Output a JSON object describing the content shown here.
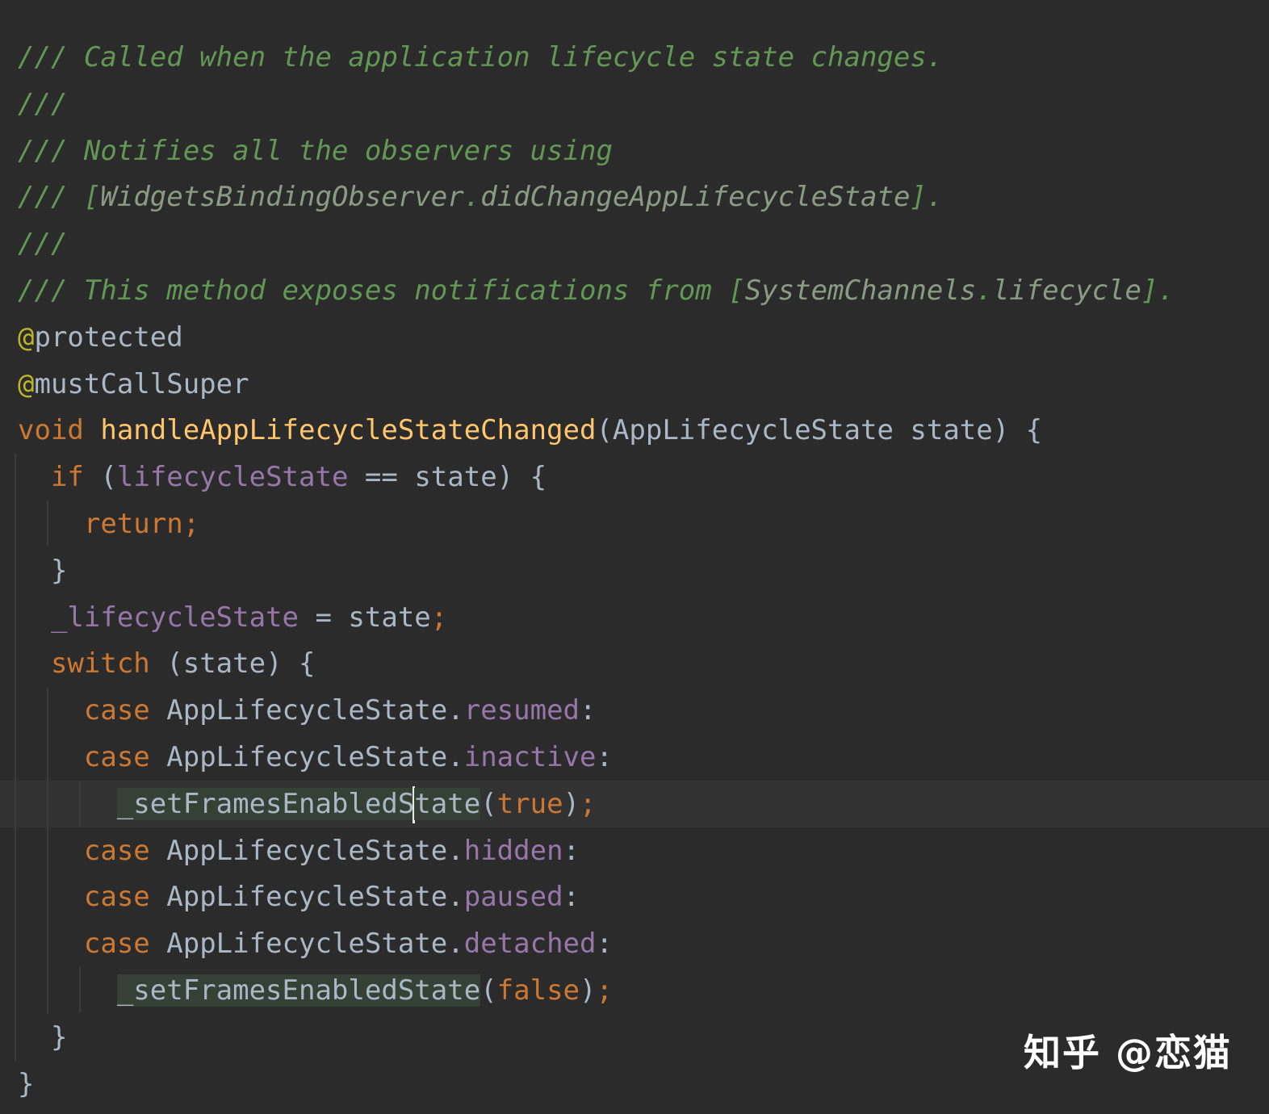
{
  "editor": {
    "lines": [
      {
        "tokens": [
          {
            "c": "tok-comment",
            "t": "/// Called when the application lifecycle state changes."
          }
        ]
      },
      {
        "tokens": [
          {
            "c": "tok-comment",
            "t": "///"
          }
        ]
      },
      {
        "tokens": [
          {
            "c": "tok-comment",
            "t": "/// Notifies all the observers using"
          }
        ]
      },
      {
        "tokens": [
          {
            "c": "tok-comment",
            "t": "/// "
          },
          {
            "c": "tok-comment",
            "t": "["
          },
          {
            "c": "tok-ref",
            "t": "WidgetsBindingObserver"
          },
          {
            "c": "tok-comment",
            "t": "."
          },
          {
            "c": "tok-ref",
            "t": "didChangeAppLifecycleState"
          },
          {
            "c": "tok-comment",
            "t": "]."
          }
        ]
      },
      {
        "tokens": [
          {
            "c": "tok-comment",
            "t": "///"
          }
        ]
      },
      {
        "tokens": [
          {
            "c": "tok-comment",
            "t": "/// This method exposes notifications from "
          },
          {
            "c": "tok-comment",
            "t": "["
          },
          {
            "c": "tok-ref",
            "t": "SystemChannels"
          },
          {
            "c": "tok-comment",
            "t": "."
          },
          {
            "c": "tok-ref",
            "t": "lifecycle"
          },
          {
            "c": "tok-comment",
            "t": "]."
          }
        ]
      },
      {
        "tokens": [
          {
            "c": "tok-annotation",
            "t": "@"
          },
          {
            "c": "tok-plain",
            "t": "protected"
          }
        ]
      },
      {
        "tokens": [
          {
            "c": "tok-annotation",
            "t": "@"
          },
          {
            "c": "tok-plain",
            "t": "mustCallSuper"
          }
        ]
      },
      {
        "tokens": [
          {
            "c": "tok-keyword",
            "t": "void "
          },
          {
            "c": "tok-func",
            "t": "handleAppLifecycleStateChanged"
          },
          {
            "c": "tok-plain",
            "t": "(AppLifecycleState state) {"
          }
        ]
      },
      {
        "tokens": [
          {
            "c": "tok-plain",
            "t": "  "
          },
          {
            "c": "tok-keyword",
            "t": "if"
          },
          {
            "c": "tok-plain",
            "t": " ("
          },
          {
            "c": "tok-field",
            "t": "lifecycleState"
          },
          {
            "c": "tok-plain",
            "t": " == state) {"
          }
        ]
      },
      {
        "tokens": [
          {
            "c": "tok-plain",
            "t": "    "
          },
          {
            "c": "tok-keyword",
            "t": "return"
          },
          {
            "c": "tok-punct",
            "t": ";"
          }
        ]
      },
      {
        "tokens": [
          {
            "c": "tok-plain",
            "t": "  }"
          }
        ]
      },
      {
        "tokens": [
          {
            "c": "tok-plain",
            "t": "  "
          },
          {
            "c": "tok-field",
            "t": "_lifecycleState"
          },
          {
            "c": "tok-plain",
            "t": " = state"
          },
          {
            "c": "tok-punct",
            "t": ";"
          }
        ]
      },
      {
        "tokens": [
          {
            "c": "tok-plain",
            "t": "  "
          },
          {
            "c": "tok-keyword",
            "t": "switch"
          },
          {
            "c": "tok-plain",
            "t": " (state) {"
          }
        ]
      },
      {
        "tokens": [
          {
            "c": "tok-plain",
            "t": "    "
          },
          {
            "c": "tok-keyword",
            "t": "case"
          },
          {
            "c": "tok-plain",
            "t": " AppLifecycleState."
          },
          {
            "c": "tok-field",
            "t": "resumed"
          },
          {
            "c": "tok-plain",
            "t": ":"
          }
        ]
      },
      {
        "tokens": [
          {
            "c": "tok-plain",
            "t": "    "
          },
          {
            "c": "tok-keyword",
            "t": "case"
          },
          {
            "c": "tok-plain",
            "t": " AppLifecycleState."
          },
          {
            "c": "tok-field",
            "t": "inactive"
          },
          {
            "c": "tok-plain",
            "t": ":"
          }
        ]
      },
      {
        "current": true,
        "tokens": [
          {
            "c": "tok-plain",
            "t": "      "
          },
          {
            "c": "tok-plain tok-highlight",
            "t": "_setFramesEnabledS"
          },
          {
            "caret": true
          },
          {
            "c": "tok-plain tok-highlight",
            "t": "tate"
          },
          {
            "c": "tok-plain",
            "t": "("
          },
          {
            "c": "tok-keyword",
            "t": "true"
          },
          {
            "c": "tok-plain",
            "t": ")"
          },
          {
            "c": "tok-punct",
            "t": ";"
          }
        ]
      },
      {
        "tokens": [
          {
            "c": "tok-plain",
            "t": "    "
          },
          {
            "c": "tok-keyword",
            "t": "case"
          },
          {
            "c": "tok-plain",
            "t": " AppLifecycleState."
          },
          {
            "c": "tok-field",
            "t": "hidden"
          },
          {
            "c": "tok-plain",
            "t": ":"
          }
        ]
      },
      {
        "tokens": [
          {
            "c": "tok-plain",
            "t": "    "
          },
          {
            "c": "tok-keyword",
            "t": "case"
          },
          {
            "c": "tok-plain",
            "t": " AppLifecycleState."
          },
          {
            "c": "tok-field",
            "t": "paused"
          },
          {
            "c": "tok-plain",
            "t": ":"
          }
        ]
      },
      {
        "tokens": [
          {
            "c": "tok-plain",
            "t": "    "
          },
          {
            "c": "tok-keyword",
            "t": "case"
          },
          {
            "c": "tok-plain",
            "t": " AppLifecycleState."
          },
          {
            "c": "tok-field",
            "t": "detached"
          },
          {
            "c": "tok-plain",
            "t": ":"
          }
        ]
      },
      {
        "tokens": [
          {
            "c": "tok-plain",
            "t": "      "
          },
          {
            "c": "tok-plain tok-highlight",
            "t": "_setFramesEnabledState"
          },
          {
            "c": "tok-plain",
            "t": "("
          },
          {
            "c": "tok-keyword",
            "t": "false"
          },
          {
            "c": "tok-plain",
            "t": ")"
          },
          {
            "c": "tok-punct",
            "t": ";"
          }
        ]
      },
      {
        "tokens": [
          {
            "c": "tok-plain",
            "t": "  }"
          }
        ]
      },
      {
        "tokens": [
          {
            "c": "tok-plain",
            "t": "}"
          }
        ]
      }
    ]
  },
  "watermark": {
    "text": "知乎 @恋猫"
  },
  "colors": {
    "background": "#2b2b2b",
    "comment": "#629755",
    "keyword": "#cc7832",
    "function": "#ffc66d",
    "field": "#9876aa",
    "annotation": "#bbb529",
    "plain": "#a9b7c6"
  }
}
